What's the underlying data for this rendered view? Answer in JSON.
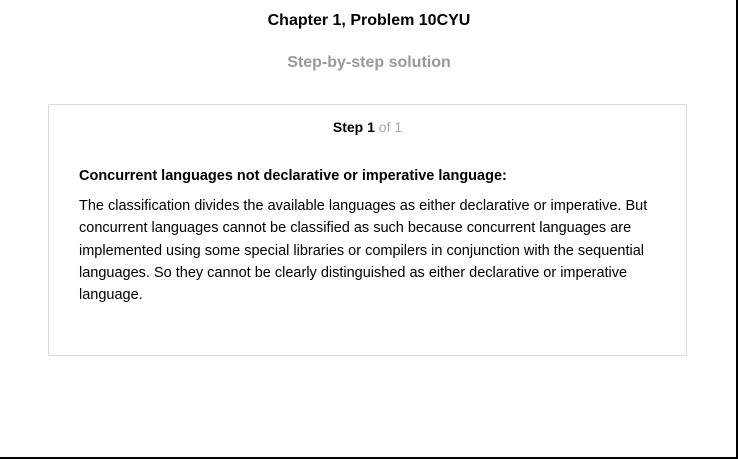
{
  "header": {
    "title": "Chapter 1, Problem 10CYU",
    "subtitle": "Step-by-step solution"
  },
  "step": {
    "label": "Step",
    "number": "1",
    "of_text": "of 1",
    "heading": "Concurrent languages not declarative or imperative language:",
    "body": "The classification divides the available languages as either declarative or imperative. But concurrent languages cannot be classified as such because concurrent languages are implemented using some special libraries or compilers in conjunction with the sequential languages. So they cannot be clearly distinguished as either declarative or imperative language."
  },
  "colors": {
    "subtitle": "#999999",
    "step_of": "#a9a9a9",
    "card_border": "#dcdcdc",
    "frame": "#000000"
  }
}
